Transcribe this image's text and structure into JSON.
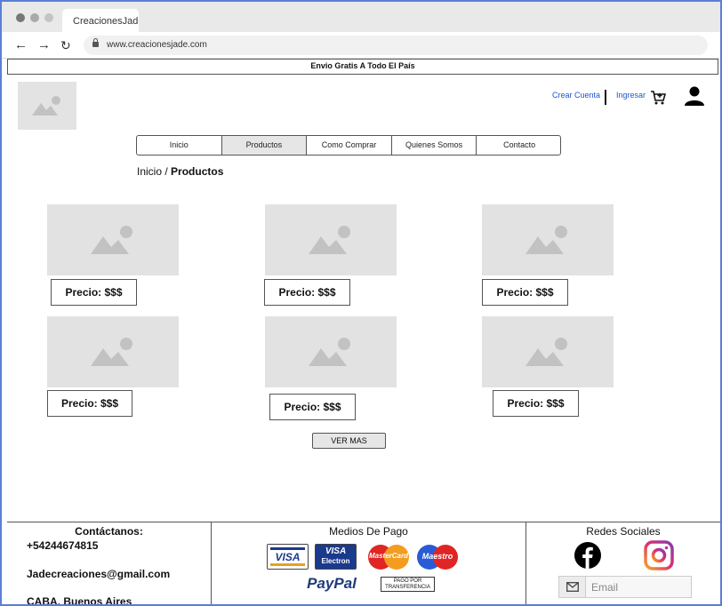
{
  "browser": {
    "tab_title": "CreacionesJade",
    "url": "www.creacionesjade.com"
  },
  "promo": "Envio Gratis A Todo El País",
  "header": {
    "create_account": "Crear Cuenta",
    "login": "Ingresar"
  },
  "menu": [
    {
      "label": "Inicio"
    },
    {
      "label": "Productos",
      "active": true
    },
    {
      "label": "Como Comprar"
    },
    {
      "label": "Quienes Somos"
    },
    {
      "label": "Contacto"
    }
  ],
  "breadcrumb": {
    "home": "Inicio",
    "separator": " / ",
    "current": "Productos"
  },
  "products": [
    {
      "price": "Precio: $$$"
    },
    {
      "price": "Precio: $$$"
    },
    {
      "price": "Precio: $$$"
    },
    {
      "price": "Precio: $$$"
    },
    {
      "price": "Precio: $$$"
    },
    {
      "price": "Precio: $$$"
    }
  ],
  "ver_mas": "VER MAS",
  "footer": {
    "contact_title": "Contáctanos:",
    "phone": "+54244674815",
    "email": "Jadecreaciones@gmail.com",
    "location": "CABA, Buenos Aires",
    "payments_title": "Medios De Pago",
    "payment_methods": {
      "visa": "VISA",
      "visa_electron_1": "VISA",
      "visa_electron_2": "Electron",
      "mastercard": "MasterCard",
      "maestro": "Maestro",
      "paypal": "PayPal",
      "transfer_1": "PAGO POR",
      "transfer_2": "TRANSFERENCIA"
    },
    "social_title": "Redes Sociales",
    "email_placeholder": "Email"
  },
  "colors": {
    "link": "#1a56d6",
    "placeholder": "#e2e2e2",
    "border": "#555555",
    "frame": "#5b7fd6"
  }
}
